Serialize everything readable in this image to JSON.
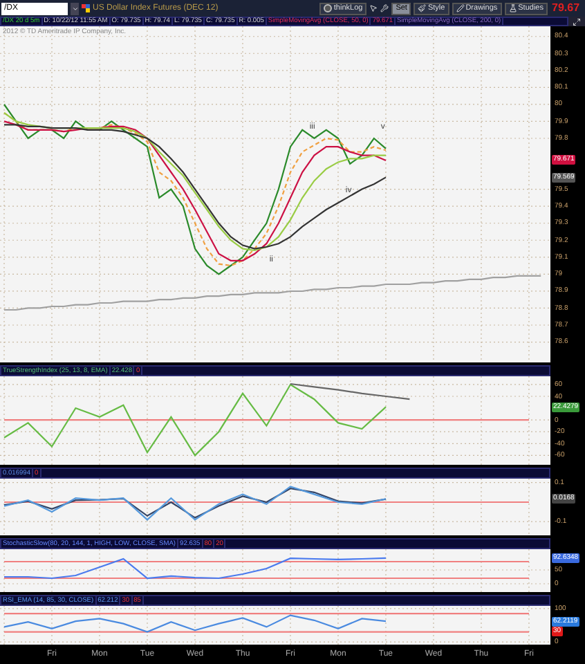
{
  "toolbar": {
    "symbol": "/DX",
    "description": "US Dollar Index Futures (DEC 12)",
    "buttons": [
      {
        "label": "thinkLog",
        "kind": "circle",
        "selected": false
      },
      {
        "label": "Set",
        "kind": "plain",
        "selected": true
      },
      {
        "label": "Style",
        "kind": "style",
        "selected": false
      },
      {
        "label": "Drawings",
        "kind": "pencil",
        "selected": false
      },
      {
        "label": "Studies",
        "kind": "flask",
        "selected": false
      }
    ],
    "last_price": "79.67"
  },
  "panels": [
    {
      "header": [
        {
          "text": "/DX 20 d 5m",
          "kind": "symbol"
        },
        {
          "text": "D: 10/22/12 11:55 AM",
          "kind": "info"
        },
        {
          "text": "O: 79.735",
          "kind": "info"
        },
        {
          "text": "H: 79.74",
          "kind": "info"
        },
        {
          "text": "L: 79.735",
          "kind": "info"
        },
        {
          "text": "C: 79.735",
          "kind": "info"
        },
        {
          "text": "R: 0.005",
          "kind": "info"
        },
        {
          "text": "SimpleMovingAvg (CLOSE, 50, 0)",
          "kind": "sma50"
        },
        {
          "text": "79.671",
          "kind": "sma50"
        },
        {
          "text": "SimpleMovingAvg (CLOSE, 200, 0)",
          "kind": "sma200"
        }
      ],
      "copyright": "2012 © TD Ameritrade IP Company, Inc.",
      "wave_labels": [
        "ii",
        "iii",
        "iv",
        "v"
      ],
      "value_labels": [
        {
          "text": "79.671",
          "color": "#d01040"
        },
        {
          "text": "79.569",
          "color": "#555555"
        }
      ],
      "chart_data": {
        "type": "line",
        "grid": true,
        "categories": [
          null,
          null,
          null,
          null,
          null,
          null,
          null,
          null,
          null,
          null,
          null,
          null,
          null,
          null,
          null,
          null,
          null,
          null,
          null,
          null,
          null,
          null,
          null,
          null,
          null,
          null,
          null,
          null,
          null,
          null,
          null,
          null,
          null,
          null,
          null,
          null,
          null,
          null,
          null,
          null,
          null,
          null,
          null,
          null,
          null,
          null
        ],
        "series": [
          {
            "color": "#a0a0a0",
            "values": [
              78.79,
              78.79,
              78.8,
              78.8,
              78.81,
              78.81,
              78.82,
              78.82,
              78.83,
              78.83,
              78.84,
              78.84,
              78.84,
              78.85,
              78.85,
              78.86,
              78.86,
              78.87,
              78.87,
              78.88,
              78.88,
              78.89,
              78.89,
              78.89,
              78.9,
              78.9,
              78.91,
              78.91,
              78.92,
              78.92,
              78.93,
              78.93,
              78.94,
              78.94,
              78.94,
              78.95,
              78.95,
              78.96,
              78.96,
              78.97,
              78.97,
              78.98,
              78.98,
              78.99,
              78.99,
              78.99
            ]
          },
          {
            "color": "#2a8a2a",
            "values": [
              80.0,
              79.9,
              79.8,
              79.85,
              79.85,
              79.8,
              79.9,
              79.85,
              79.85,
              79.9,
              79.85,
              79.8,
              79.75,
              79.45,
              79.5,
              79.4,
              79.15,
              79.05,
              79.0,
              79.05,
              79.1,
              79.2,
              79.3,
              79.5,
              79.75,
              79.85,
              79.8,
              79.85,
              79.8,
              79.65,
              79.7,
              79.8,
              79.74,
              null,
              null,
              null,
              null,
              null,
              null,
              null,
              null,
              null,
              null,
              null,
              null,
              null
            ]
          },
          {
            "color": "#f0a040",
            "line_style": "dashed",
            "values": [
              79.95,
              79.9,
              79.85,
              79.85,
              79.85,
              79.84,
              79.86,
              79.86,
              79.86,
              79.88,
              79.86,
              79.83,
              79.78,
              79.6,
              79.55,
              79.45,
              79.3,
              79.15,
              79.06,
              79.05,
              79.08,
              79.15,
              79.24,
              79.4,
              79.6,
              79.72,
              79.76,
              79.8,
              79.79,
              79.72,
              79.72,
              79.75,
              79.73,
              null,
              null,
              null,
              null,
              null,
              null,
              null,
              null,
              null,
              null,
              null,
              null,
              null
            ]
          },
          {
            "color": "#cc1144",
            "values": [
              79.9,
              79.88,
              79.85,
              79.85,
              79.85,
              79.84,
              79.85,
              79.86,
              79.86,
              79.87,
              79.87,
              79.85,
              79.8,
              79.7,
              79.6,
              79.5,
              79.38,
              79.25,
              79.12,
              79.08,
              79.08,
              79.12,
              79.18,
              79.3,
              79.45,
              79.6,
              79.7,
              79.75,
              79.75,
              79.72,
              79.7,
              79.7,
              79.67,
              null,
              null,
              null,
              null,
              null,
              null,
              null,
              null,
              null,
              null,
              null,
              null,
              null
            ]
          },
          {
            "color": "#99cc44",
            "values": [
              79.95,
              79.9,
              79.88,
              79.87,
              79.86,
              79.86,
              79.86,
              79.86,
              79.86,
              79.86,
              79.86,
              79.84,
              79.8,
              79.72,
              79.65,
              79.58,
              79.48,
              79.38,
              79.28,
              79.2,
              79.15,
              79.14,
              79.16,
              79.22,
              79.32,
              79.45,
              79.55,
              79.62,
              79.66,
              79.68,
              79.68,
              79.7,
              79.7,
              null,
              null,
              null,
              null,
              null,
              null,
              null,
              null,
              null,
              null,
              null,
              null,
              null
            ]
          },
          {
            "color": "#333333",
            "values": [
              79.88,
              79.88,
              79.87,
              79.87,
              79.86,
              79.86,
              79.86,
              79.85,
              79.85,
              79.85,
              79.84,
              79.82,
              79.8,
              79.75,
              79.68,
              79.6,
              79.5,
              79.4,
              79.3,
              79.22,
              79.17,
              79.15,
              79.16,
              79.18,
              79.22,
              79.28,
              79.33,
              79.38,
              79.42,
              79.46,
              79.5,
              79.53,
              79.57,
              null,
              null,
              null,
              null,
              null,
              null,
              null,
              null,
              null,
              null,
              null,
              null,
              null
            ]
          }
        ],
        "ylim": [
          78.48,
          80.46
        ],
        "yticks": [
          80.4,
          80.3,
          80.2,
          80.1,
          80,
          79.9,
          79.8,
          79.5,
          79.4,
          79.3,
          79.2,
          79.1,
          79,
          78.9,
          78.8,
          78.7,
          78.6
        ]
      }
    },
    {
      "header": [
        {
          "text": "TrueStrengthIndex (25, 13, 8, EMA)",
          "kind": "tsi"
        },
        {
          "text": "22.428",
          "kind": "tsi"
        },
        {
          "text": "0",
          "kind": "limit"
        }
      ],
      "value_labels": [
        {
          "text": "22.4279",
          "color": "#3a9a3a"
        }
      ],
      "chart_data": {
        "type": "line",
        "grid": true,
        "categories": [
          null,
          null,
          null,
          null,
          null,
          null,
          null,
          null,
          null,
          null,
          null,
          null,
          null,
          null,
          null,
          null,
          null,
          null,
          null,
          null,
          null,
          null,
          null
        ],
        "series": [
          {
            "color": "#f08080",
            "values": [
              0,
              0,
              0,
              0,
              0,
              0,
              0,
              0,
              0,
              0,
              0,
              0,
              0,
              0,
              0,
              0,
              0,
              0,
              0,
              0,
              0,
              0,
              0
            ]
          },
          {
            "color": "#66bb44",
            "values": [
              -30,
              -5,
              -45,
              20,
              5,
              25,
              -55,
              5,
              -60,
              -20,
              45,
              -10,
              60,
              35,
              -5,
              -15,
              22,
              null,
              null,
              null,
              null,
              null,
              null
            ]
          },
          {
            "color": "#666666",
            "values": [
              null,
              null,
              null,
              null,
              null,
              null,
              null,
              null,
              null,
              null,
              null,
              null,
              61,
              56,
              51,
              45,
              40,
              35,
              null,
              null,
              null,
              null,
              null
            ]
          }
        ],
        "ylim": [
          -76,
          74
        ],
        "yticks": [
          60,
          40,
          0,
          -20,
          -40,
          -60
        ]
      }
    },
    {
      "header": [
        {
          "text": "0.016994",
          "kind": "osc"
        },
        {
          "text": "0",
          "kind": "limit"
        }
      ],
      "value_labels": [
        {
          "text": "0.0168",
          "color": "#444444"
        }
      ],
      "chart_data": {
        "type": "line",
        "grid": true,
        "categories": [
          null,
          null,
          null,
          null,
          null,
          null,
          null,
          null,
          null,
          null,
          null,
          null,
          null,
          null,
          null,
          null,
          null,
          null,
          null,
          null,
          null,
          null,
          null
        ],
        "series": [
          {
            "color": "#f08080",
            "values": [
              0,
              0,
              0,
              0,
              0,
              0,
              0,
              0,
              0,
              0,
              0,
              0,
              0,
              0,
              0,
              0,
              0,
              0,
              0,
              0,
              0,
              0,
              0
            ]
          },
          {
            "color": "#334466",
            "values": [
              -0.015,
              0.005,
              -0.035,
              0.01,
              0.012,
              0.018,
              -0.07,
              0.0,
              -0.08,
              -0.02,
              0.03,
              0.0,
              0.07,
              0.05,
              0.005,
              -0.005,
              0.015,
              null,
              null,
              null,
              null,
              null,
              null
            ]
          },
          {
            "color": "#5599dd",
            "values": [
              -0.02,
              0.01,
              -0.05,
              0.02,
              0.01,
              0.02,
              -0.09,
              0.02,
              -0.09,
              -0.01,
              0.04,
              -0.01,
              0.08,
              0.04,
              0.0,
              -0.01,
              0.017,
              null,
              null,
              null,
              null,
              null,
              null
            ]
          }
        ],
        "ylim": [
          -0.17,
          0.12
        ],
        "yticks": [
          0.1,
          -0.1
        ]
      }
    },
    {
      "header": [
        {
          "text": "StochasticSlow(80, 20, 144, 1, HIGH, LOW, CLOSE, SMA)",
          "kind": "stoch"
        },
        {
          "text": "92.635",
          "kind": "stoch"
        },
        {
          "text": "80",
          "kind": "limit"
        },
        {
          "text": "20",
          "kind": "limit"
        }
      ],
      "value_labels": [
        {
          "text": "92.6348",
          "color": "#3a6adf"
        }
      ],
      "chart_data": {
        "type": "line",
        "grid": true,
        "categories": [
          null,
          null,
          null,
          null,
          null,
          null,
          null,
          null,
          null,
          null,
          null,
          null,
          null,
          null,
          null,
          null,
          null,
          null,
          null,
          null,
          null,
          null,
          null
        ],
        "series": [
          {
            "color": "#f08080",
            "values": [
              80,
              80,
              80,
              80,
              80,
              80,
              80,
              80,
              80,
              80,
              80,
              80,
              80,
              80,
              80,
              80,
              80,
              80,
              80,
              80,
              80,
              80,
              80
            ]
          },
          {
            "color": "#f08080",
            "values": [
              20,
              20,
              20,
              20,
              20,
              20,
              20,
              20,
              20,
              20,
              20,
              20,
              20,
              20,
              20,
              20,
              20,
              20,
              20,
              20,
              20,
              20,
              20
            ]
          },
          {
            "color": "#4a7aee",
            "values": [
              25,
              25,
              20,
              30,
              60,
              90,
              20,
              28,
              22,
              20,
              35,
              55,
              92,
              90,
              88,
              90,
              93,
              null,
              null,
              null,
              null,
              null,
              null
            ]
          }
        ],
        "ylim": [
          -30,
          125
        ],
        "yticks": [
          50,
          0
        ]
      }
    },
    {
      "header": [
        {
          "text": "RSI_EMA (14, 85, 30, CLOSE)",
          "kind": "rsi"
        },
        {
          "text": "62.212",
          "kind": "rsi"
        },
        {
          "text": "30",
          "kind": "limit"
        },
        {
          "text": "85",
          "kind": "limit"
        }
      ],
      "value_labels": [
        {
          "text": "62.2119",
          "color": "#2a7add"
        },
        {
          "text": "30",
          "color": "#e01818"
        }
      ],
      "chart_data": {
        "type": "line",
        "grid": true,
        "categories": [
          null,
          null,
          "Fri",
          null,
          "Mon",
          null,
          "Tue",
          null,
          "Wed",
          null,
          "Thu",
          null,
          "Fri",
          null,
          "Mon",
          null,
          "Tue",
          null,
          "Wed",
          null,
          "Thu",
          null,
          "Fri"
        ],
        "series": [
          {
            "color": "#f08080",
            "values": [
              85,
              85,
              85,
              85,
              85,
              85,
              85,
              85,
              85,
              85,
              85,
              85,
              85,
              85,
              85,
              85,
              85,
              85,
              85,
              85,
              85,
              85,
              85
            ]
          },
          {
            "color": "#f08080",
            "values": [
              30,
              30,
              30,
              30,
              30,
              30,
              30,
              30,
              30,
              30,
              30,
              30,
              30,
              30,
              30,
              30,
              30,
              30,
              30,
              30,
              30,
              30,
              30
            ]
          },
          {
            "color": "#4a8ae0",
            "values": [
              45,
              60,
              40,
              62,
              70,
              55,
              30,
              60,
              35,
              55,
              72,
              45,
              80,
              65,
              40,
              70,
              62,
              null,
              null,
              null,
              null,
              null,
              null
            ]
          }
        ],
        "ylim": [
          -8,
          108
        ],
        "yticks": [
          100,
          0
        ]
      }
    }
  ]
}
